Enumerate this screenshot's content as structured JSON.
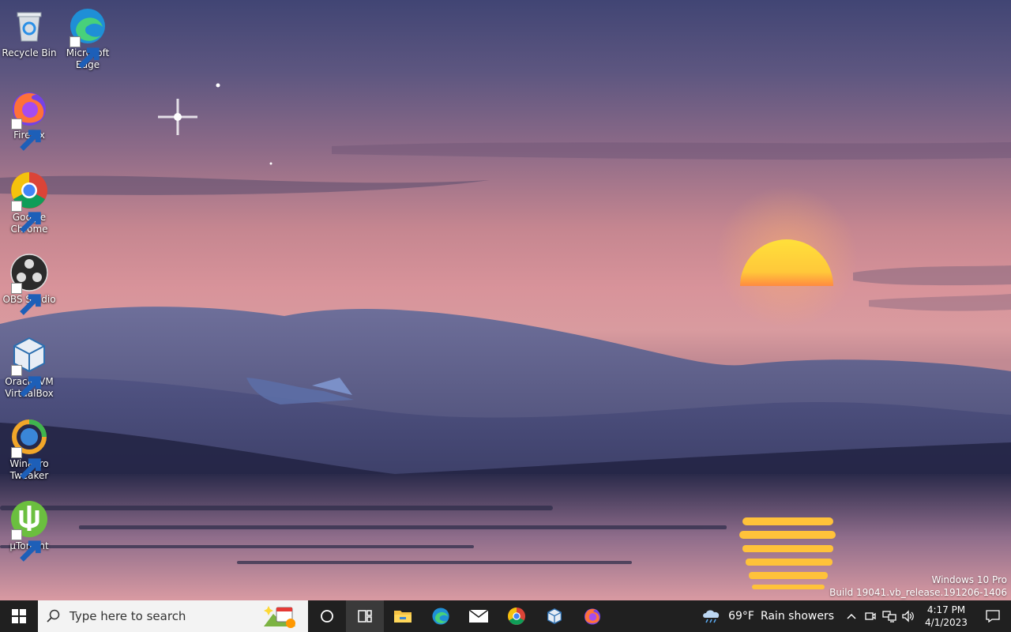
{
  "desktop": {
    "icons": [
      {
        "label_lines": [
          "Recycle Bin",
          ""
        ],
        "icon": "recycle-bin-icon"
      },
      {
        "label_lines": [
          "Microsoft",
          "Edge"
        ],
        "icon": "edge-icon"
      },
      {
        "label_lines": [
          "Firefox",
          ""
        ],
        "icon": "firefox-icon"
      },
      {
        "label_lines": [
          "Google",
          "Chrome"
        ],
        "icon": "chrome-icon"
      },
      {
        "label_lines": [
          "OBS Studio",
          ""
        ],
        "icon": "obs-icon"
      },
      {
        "label_lines": [
          "Oracle VM",
          "VirtualBox"
        ],
        "icon": "virtualbox-icon"
      },
      {
        "label_lines": [
          "Winaero",
          "Tweaker"
        ],
        "icon": "winaero-tweaker-icon"
      },
      {
        "label_lines": [
          "µTorrent",
          ""
        ],
        "icon": "utorrent-icon"
      }
    ]
  },
  "watermark": {
    "line1": "Windows 10 Pro",
    "line2": "Build 19041.vb_release.191206-1406"
  },
  "taskbar": {
    "search_placeholder": "Type here to search",
    "pinned": [
      "cortana-icon",
      "task-view-icon",
      "file-explorer-icon",
      "edge-icon",
      "mail-icon",
      "chrome-icon",
      "virtualbox-icon",
      "firefox-icon"
    ],
    "weather": {
      "temp": "69°F",
      "condition": "Rain showers"
    },
    "clock": {
      "time": "4:17 PM",
      "date": "4/1/2023"
    }
  },
  "colors": {
    "taskbar_bg": "#202020",
    "search_bg": "#f3f3f3",
    "sun": "#ffd23a"
  }
}
